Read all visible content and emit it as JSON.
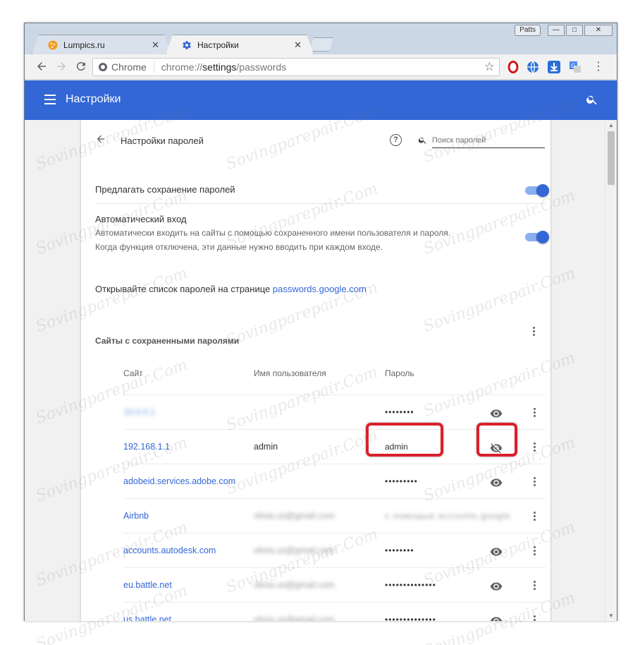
{
  "tabs": [
    {
      "label": "Lumpics.ru",
      "close": "✕"
    },
    {
      "label": "Настройки",
      "close": "✕"
    }
  ],
  "window_controls": {
    "profile": "Patts",
    "minimize": "—",
    "maximize": "□",
    "close": "✕"
  },
  "omnibox": {
    "chip": "Chrome",
    "url_prefix": "chrome://",
    "url_host": "settings",
    "url_path": "/passwords"
  },
  "appbar": {
    "title": "Настройки"
  },
  "page": {
    "title": "Настройки паролей",
    "search_placeholder": "Поиск паролей",
    "offer_save_label": "Предлагать сохранение паролей",
    "offer_save_enabled": true,
    "auto_signin_label": "Автоматический вход",
    "auto_signin_desc_1": "Автоматически входить на сайты с помощью сохраненного имени пользователя и пароля.",
    "auto_signin_desc_2": "Когда функция отключена, эти данные нужно вводить при каждом входе.",
    "auto_signin_enabled": true,
    "google_text": "Открывайте список паролей на странице ",
    "google_link": "passwords.google.com",
    "saved_section_title": "Сайты с сохраненными паролями",
    "columns": {
      "site": "Сайт",
      "user": "Имя пользователя",
      "password": "Пароль"
    }
  },
  "passwords": [
    {
      "site": "10.0.0.1",
      "user": "",
      "password": "••••••••",
      "eye": "eye-icon",
      "blur_site": true,
      "blur_user": false,
      "blur_pass": false
    },
    {
      "site": "192.168.1.1",
      "user": "admin",
      "password": "admin",
      "eye": "eye-off-icon",
      "blur_site": false,
      "blur_user": false,
      "blur_pass": false
    },
    {
      "site": "adobeid.services.adobe.com",
      "user": "",
      "password": "•••••••••",
      "eye": "eye-icon",
      "blur_site": false,
      "blur_user": false,
      "blur_pass": false
    },
    {
      "site": "Airbnb",
      "user": "olivia.us@gmail.com",
      "password": "с помощью accounts.google",
      "eye": "",
      "blur_site": false,
      "blur_user": true,
      "blur_pass": true
    },
    {
      "site": "accounts.autodesk.com",
      "user": "olivia.us@gmail.com",
      "password": "••••••••",
      "eye": "eye-icon",
      "blur_site": false,
      "blur_user": true,
      "blur_pass": false
    },
    {
      "site": "eu.battle.net",
      "user": "olivia.us@gmail.com",
      "password": "••••••••••••••",
      "eye": "eye-icon",
      "blur_site": false,
      "blur_user": true,
      "blur_pass": false
    },
    {
      "site": "us.battle.net",
      "user": "olivia.us@gmail.com",
      "password": "••••••••••••••",
      "eye": "eye-icon",
      "blur_site": false,
      "blur_user": true,
      "blur_pass": false
    }
  ],
  "watermark": "Sovingparepair.Com",
  "colors": {
    "accent": "#3367d6",
    "highlight": "#d9202a"
  }
}
